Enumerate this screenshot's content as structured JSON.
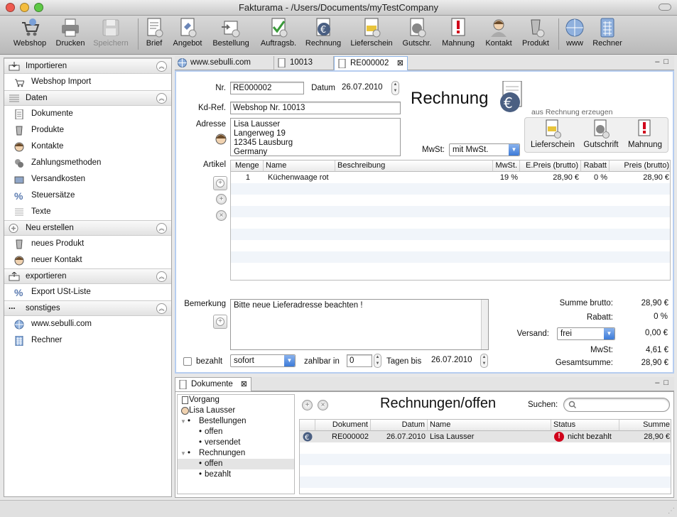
{
  "window": {
    "title": "Fakturama - /Users/Documents/myTestCompany"
  },
  "toolbar": [
    {
      "label": "Webshop",
      "icon": "cart-icon"
    },
    {
      "label": "Drucken",
      "icon": "printer-icon"
    },
    {
      "label": "Speichern",
      "icon": "floppy-icon",
      "disabled": true
    },
    {
      "label": "Brief",
      "icon": "letter-icon"
    },
    {
      "label": "Angebot",
      "icon": "offer-icon"
    },
    {
      "label": "Bestellung",
      "icon": "order-icon"
    },
    {
      "label": "Auftragsb.",
      "icon": "confirmation-icon"
    },
    {
      "label": "Rechnung",
      "icon": "invoice-icon"
    },
    {
      "label": "Lieferschein",
      "icon": "delivery-icon"
    },
    {
      "label": "Gutschr.",
      "icon": "credit-icon"
    },
    {
      "label": "Mahnung",
      "icon": "dunning-icon"
    },
    {
      "label": "Kontakt",
      "icon": "contact-icon"
    },
    {
      "label": "Produkt",
      "icon": "product-icon"
    },
    {
      "label": "www",
      "icon": "globe-icon"
    },
    {
      "label": "Rechner",
      "icon": "calculator-icon"
    }
  ],
  "sidebar": {
    "sections": [
      {
        "title": "Importieren",
        "items": [
          {
            "label": "Webshop Import"
          }
        ]
      },
      {
        "title": "Daten",
        "items": [
          {
            "label": "Dokumente"
          },
          {
            "label": "Produkte"
          },
          {
            "label": "Kontakte"
          },
          {
            "label": "Zahlungsmethoden"
          },
          {
            "label": "Versandkosten"
          },
          {
            "label": "Steuersätze"
          },
          {
            "label": "Texte"
          }
        ]
      },
      {
        "title": "Neu erstellen",
        "items": [
          {
            "label": "neues Produkt"
          },
          {
            "label": "neuer Kontakt"
          }
        ]
      },
      {
        "title": "exportieren",
        "items": [
          {
            "label": "Export USt-Liste"
          }
        ]
      },
      {
        "title": "sonstiges",
        "items": [
          {
            "label": "www.sebulli.com"
          },
          {
            "label": "Rechner"
          }
        ]
      }
    ]
  },
  "tabs": [
    {
      "label": "www.sebulli.com"
    },
    {
      "label": "10013"
    },
    {
      "label": "RE000002"
    }
  ],
  "invoice": {
    "nr_label": "Nr.",
    "nr": "RE000002",
    "datum_label": "Datum",
    "datum": "26.07.2010",
    "heading": "Rechnung",
    "kdref_label": "Kd-Ref.",
    "kdref": "Webshop Nr. 10013",
    "adresse_label": "Adresse",
    "address_lines": [
      "Lisa Lausser",
      "Langerweg 19",
      "12345 Lausburg",
      "Germany"
    ],
    "create_from_label": "aus Rechnung erzeugen",
    "create_buttons": [
      {
        "label": "Lieferschein"
      },
      {
        "label": "Gutschrift"
      },
      {
        "label": "Mahnung"
      }
    ],
    "mwst_label": "MwSt:",
    "mwst_value": "mit MwSt.",
    "artikel_label": "Artikel",
    "columns": [
      "Menge",
      "Name",
      "Beschreibung",
      "MwSt.",
      "E.Preis (brutto)",
      "Rabatt",
      "Preis (brutto)"
    ],
    "rows": [
      {
        "menge": "1",
        "name": "Küchenwaage rot",
        "beschreibung": "",
        "mwst": "19 %",
        "epreis": "28,90 €",
        "rabatt": "0 %",
        "preis": "28,90 €"
      }
    ],
    "bemerkung_label": "Bemerkung",
    "bemerkung": "Bitte neue Lieferadresse beachten !",
    "summe_brutto_label": "Summe brutto:",
    "summe_brutto": "28,90 €",
    "rabatt_label": "Rabatt:",
    "rabatt": "0 %",
    "versand_label": "Versand:",
    "versand_value": "frei",
    "versand": "0,00 €",
    "mwst_sum_label": "MwSt:",
    "mwst_sum": "4,61 €",
    "gesamt_label": "Gesamtsumme:",
    "gesamt": "28,90 €",
    "bezahlt_label": "bezahlt",
    "bezahlt_checked": false,
    "zahlung_value": "sofort",
    "zahlbar_label": "zahlbar in",
    "zahlbar_days": "0",
    "tagen_label": "Tagen bis",
    "due_date": "26.07.2010"
  },
  "documents": {
    "tab_label": "Dokumente",
    "heading": "Rechnungen/offen",
    "search_label": "Suchen:",
    "search_placeholder": "",
    "tree": [
      {
        "label": "Vorgang",
        "level": 0
      },
      {
        "label": "Lisa Lausser",
        "level": 0
      },
      {
        "label": "Bestellungen",
        "level": 0
      },
      {
        "label": "offen",
        "level": 1
      },
      {
        "label": "versendet",
        "level": 1
      },
      {
        "label": "Rechnungen",
        "level": 0
      },
      {
        "label": "offen",
        "level": 1,
        "selected": true
      },
      {
        "label": "bezahlt",
        "level": 1
      }
    ],
    "columns": [
      "Dokument",
      "Datum",
      "Name",
      "Status",
      "Summe"
    ],
    "rows": [
      {
        "dokument": "RE000002",
        "datum": "26.07.2010",
        "name": "Lisa Lausser",
        "status": "nicht bezahlt",
        "summe": "28,90 €"
      }
    ]
  },
  "colors": {
    "accent": "#3c7ad8",
    "status_red": "#d0021b",
    "selection": "#e4e4e4"
  }
}
